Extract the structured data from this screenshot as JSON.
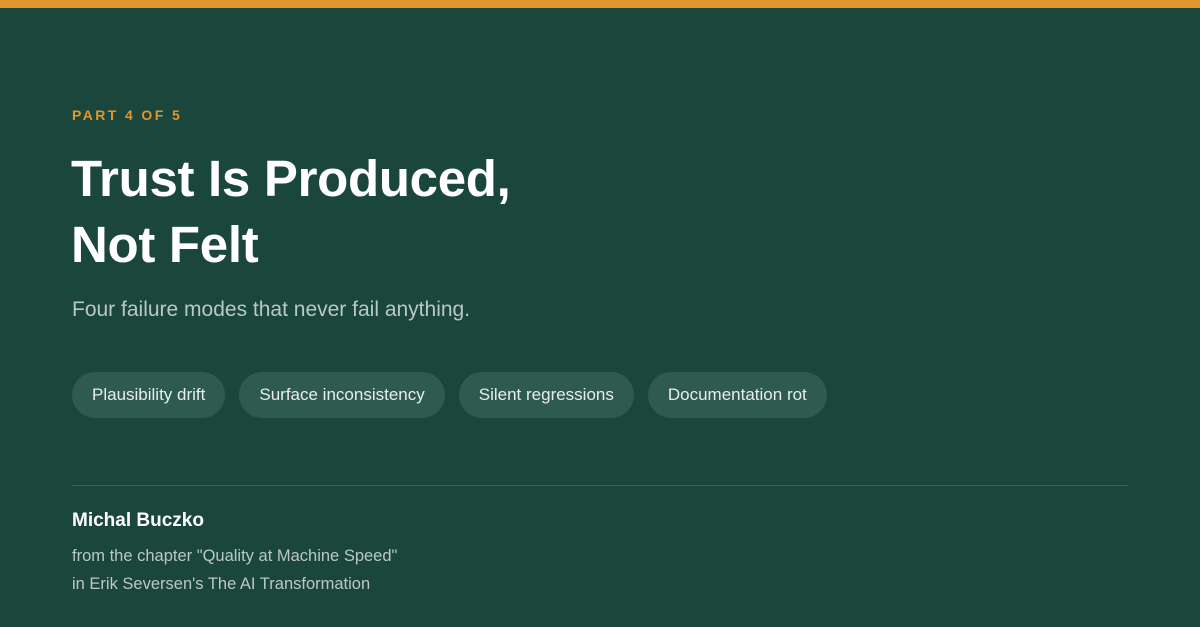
{
  "colors": {
    "background": "#1b463b",
    "accent": "#e0962c",
    "title": "#ffffff",
    "muted_text": "#b9c9c2",
    "tag_background": "#2e5a4f"
  },
  "header": {
    "series_label": "PART 4 OF 5",
    "title_lines": [
      "Trust Is Produced,",
      "Not Felt"
    ],
    "subtitle": "Four failure modes that never fail anything."
  },
  "tags": [
    "Plausibility drift",
    "Surface inconsistency",
    "Silent regressions",
    "Documentation rot"
  ],
  "footer": {
    "author": "Michal Buczko",
    "chapter_line": "from the chapter \"Quality at Machine Speed\"",
    "book_line": "in Erik Seversen's The AI Transformation"
  }
}
